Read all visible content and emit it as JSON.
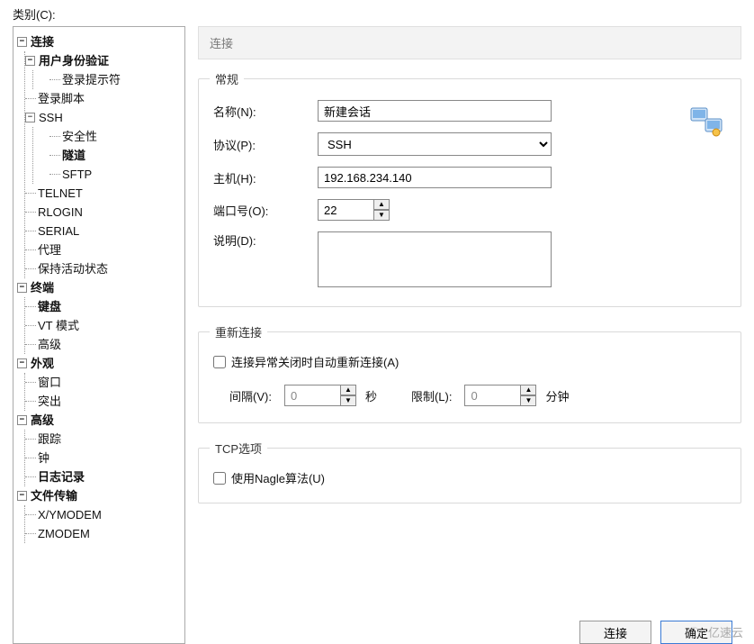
{
  "category_label": "类别(C):",
  "tree": {
    "connection": "连接",
    "user_auth": "用户身份验证",
    "login_prompt": "登录提示符",
    "login_script": "登录脚本",
    "ssh": "SSH",
    "security": "安全性",
    "tunnel": "隧道",
    "sftp": "SFTP",
    "telnet": "TELNET",
    "rlogin": "RLOGIN",
    "serial": "SERIAL",
    "proxy": "代理",
    "keep_alive": "保持活动状态",
    "terminal": "终端",
    "keyboard": "键盘",
    "vt_mode": "VT 模式",
    "advanced_term": "高级",
    "appearance": "外观",
    "window": "窗口",
    "highlight": "突出",
    "advanced": "高级",
    "tracking": "跟踪",
    "bell": "钟",
    "logging": "日志记录",
    "file_transfer": "文件传输",
    "xy_modem": "X/YMODEM",
    "zmodem": "ZMODEM"
  },
  "header_title": "连接",
  "general": {
    "legend": "常规",
    "name_label": "名称(N):",
    "name_value": "新建会话",
    "protocol_label": "协议(P):",
    "protocol_value": "SSH",
    "host_label": "主机(H):",
    "host_value": "192.168.234.140",
    "port_label": "端口号(O):",
    "port_value": "22",
    "desc_label": "说明(D):",
    "desc_value": ""
  },
  "reconnect": {
    "legend": "重新连接",
    "auto_label": "连接异常关闭时自动重新连接(A)",
    "interval_label": "间隔(V):",
    "interval_value": "0",
    "interval_unit": "秒",
    "limit_label": "限制(L):",
    "limit_value": "0",
    "limit_unit": "分钟"
  },
  "tcp": {
    "legend": "TCP选项",
    "nagle_label": "使用Nagle算法(U)"
  },
  "buttons": {
    "connect": "连接",
    "ok": "确定"
  },
  "watermark": "亿速云"
}
